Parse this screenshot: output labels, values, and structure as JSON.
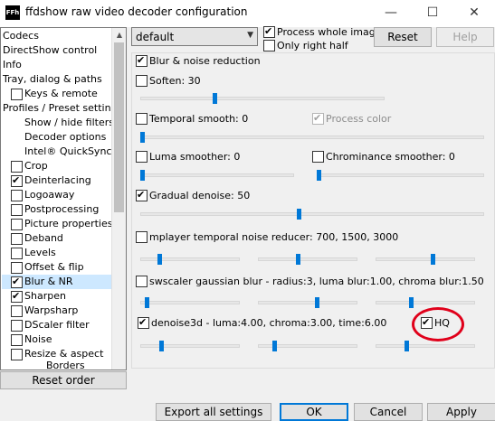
{
  "window": {
    "title": "ffdshow raw video decoder configuration",
    "icon_text": "FFh"
  },
  "title_buttons": {
    "minimize": "—",
    "maximize": "☐",
    "close": "✕"
  },
  "left_panel": {
    "items": [
      {
        "label": "Codecs"
      },
      {
        "label": "DirectShow control"
      },
      {
        "label": "Info"
      },
      {
        "label": "Tray, dialog & paths"
      },
      {
        "label": "Keys & remote",
        "checkbox": false
      },
      {
        "label": "Profiles / Preset settings"
      },
      {
        "label": "Show / hide filters"
      },
      {
        "label": "Decoder options"
      },
      {
        "label": "Intel® QuickSync"
      },
      {
        "label": "Crop",
        "checkbox": false
      },
      {
        "label": "Deinterlacing",
        "checkbox": true
      },
      {
        "label": "Logoaway",
        "checkbox": false
      },
      {
        "label": "Postprocessing",
        "checkbox": false
      },
      {
        "label": "Picture properties",
        "checkbox": false
      },
      {
        "label": "Deband",
        "checkbox": false
      },
      {
        "label": "Levels",
        "checkbox": false
      },
      {
        "label": "Offset & flip",
        "checkbox": false
      },
      {
        "label": "Blur & NR",
        "checkbox": true,
        "selected": true
      },
      {
        "label": "Sharpen",
        "checkbox": true
      },
      {
        "label": "Warpsharp",
        "checkbox": false
      },
      {
        "label": "DScaler filter",
        "checkbox": false
      },
      {
        "label": "Noise",
        "checkbox": false
      },
      {
        "label": "Resize & aspect",
        "checkbox": false
      },
      {
        "label": "Borders"
      }
    ],
    "reset_order": "Reset order"
  },
  "top": {
    "preset_value": "default",
    "process_whole_image": {
      "label": "Process whole image",
      "checked": true
    },
    "only_right_half": {
      "label": "Only right half",
      "checked": false
    },
    "reset": "Reset",
    "help": "Help"
  },
  "filters": {
    "blur_nr": {
      "label": "Blur & noise reduction",
      "checked": true
    },
    "soften": {
      "label": "Soften: 30",
      "checked": false,
      "level": 0.3
    },
    "temporal_smooth": {
      "label": "Temporal smooth: 0",
      "checked": false,
      "level": 0
    },
    "process_color": {
      "label": "Process color",
      "checked": true
    },
    "luma_smoother": {
      "label": "Luma smoother: 0",
      "checked": false,
      "level": 0
    },
    "chroma_smoother": {
      "label": "Chrominance smoother: 0",
      "checked": false,
      "level": 0
    },
    "gradual_denoise": {
      "label": "Gradual denoise: 50",
      "checked": true,
      "level": 0.5
    },
    "mplayer_tnr": {
      "label": "mplayer temporal noise reducer: 700, 1500, 3000",
      "checked": false,
      "levels": [
        0.18,
        0.4,
        0.58
      ]
    },
    "swscaler": {
      "label": "swscaler gaussian blur - radius:3, luma blur:1.00, chroma blur:1.50",
      "checked": false,
      "levels": [
        0.05,
        0.6,
        0.35
      ]
    },
    "denoise3d": {
      "label": "denoise3d - luma:4.00, chroma:3.00, time:6.00",
      "checked": true,
      "levels": [
        0.2,
        0.15,
        0.3
      ]
    },
    "hq": {
      "label": "HQ",
      "checked": true
    }
  },
  "bottom": {
    "export": "Export all settings",
    "ok": "OK",
    "cancel": "Cancel",
    "apply": "Apply"
  },
  "colors": {
    "accent": "#0078d7",
    "annotation": "#e0001a",
    "selection": "#cde8ff"
  }
}
